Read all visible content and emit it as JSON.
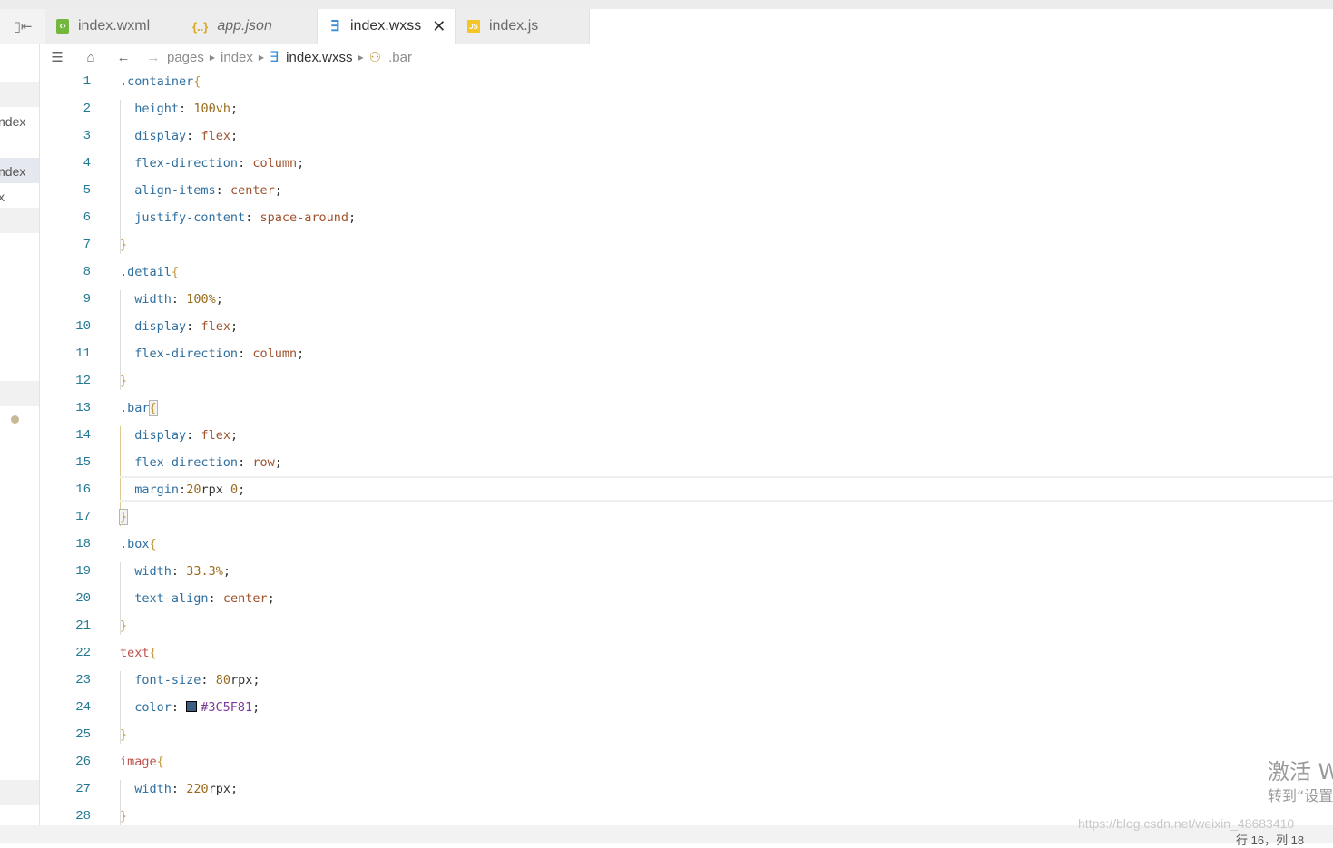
{
  "tabs": [
    {
      "label": "index.wxml",
      "icon": "wxml-file-icon"
    },
    {
      "label": "app.json",
      "icon": "json-braces-icon"
    },
    {
      "label": "index.wxss",
      "icon": "wxss-file-icon",
      "active": true,
      "close": "✕"
    },
    {
      "label": "index.js",
      "icon": "js-file-icon",
      "badge": "JS"
    }
  ],
  "breadcrumb": {
    "segments": [
      "pages",
      "index",
      "index.wxss",
      ".bar"
    ]
  },
  "sidebar": {
    "items": [
      "ndex",
      "ndex",
      "x"
    ]
  },
  "code_lines": [
    ".container{",
    "  height: 100vh;",
    "  display: flex;",
    "  flex-direction: column;",
    "  align-items: center;",
    "  justify-content: space-around;",
    "}",
    ".detail{",
    "  width: 100%;",
    "  display: flex;",
    "  flex-direction: column;",
    "}",
    ".bar{",
    "  display: flex;",
    "  flex-direction: row;",
    "  margin:20rpx 0;",
    "}",
    ".box{",
    "  width: 33.3%;",
    "  text-align: center;",
    "}",
    "text{",
    "  font-size: 80rpx;",
    "  color: #3C5F81;",
    "}",
    "image{",
    "  width: 220rpx;",
    "}"
  ],
  "line_numbers": [
    "1",
    "2",
    "3",
    "4",
    "5",
    "6",
    "7",
    "8",
    "9",
    "10",
    "11",
    "12",
    "13",
    "14",
    "15",
    "16",
    "17",
    "18",
    "19",
    "20",
    "21",
    "22",
    "23",
    "24",
    "25",
    "26",
    "27",
    "28"
  ],
  "color_swatch": "#3C5F81",
  "status": {
    "text": "行 16，列 18"
  },
  "overlay": {
    "activation_title": "激活 W",
    "activation_sub": "转到“设置",
    "watermark": "https://blog.csdn.net/weixin_48683410"
  }
}
